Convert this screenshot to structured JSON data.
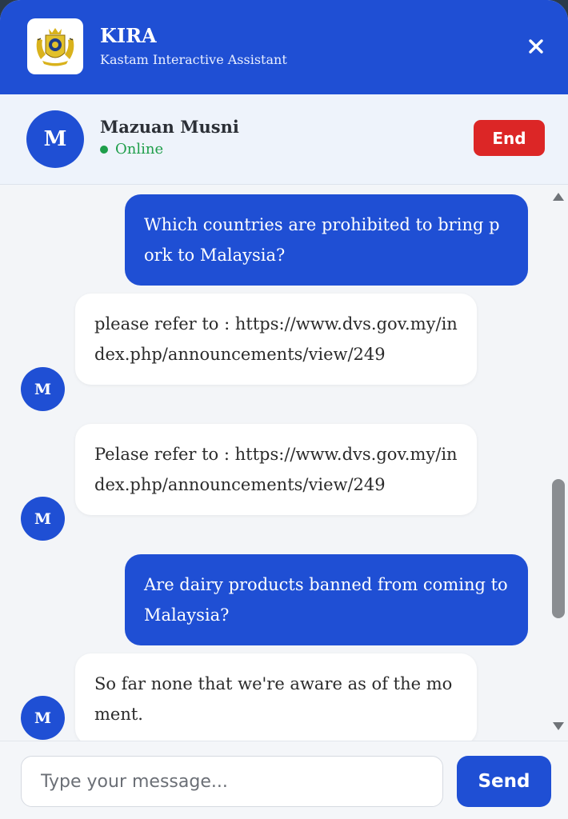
{
  "header": {
    "title": "KIRA",
    "subtitle": "Kastam Interactive Assistant",
    "logo_icon": "customs-crest-icon",
    "close_icon": "close-icon"
  },
  "agent": {
    "initial": "M",
    "name": "Mazuan Musni",
    "status": "Online",
    "end_label": "End"
  },
  "messages": [
    {
      "from": "user",
      "text": "Which countries are prohibited to bring pork to Malaysia?"
    },
    {
      "from": "agent",
      "initial": "M",
      "text": "please refer to : https://www.dvs.gov.my/index.php/announcements/view/249"
    },
    {
      "from": "agent",
      "initial": "M",
      "text": "Pelase refer to : https://www.dvs.gov.my/index.php/announcements/view/249"
    },
    {
      "from": "user",
      "text": "Are dairy products banned from coming to Malaysia?"
    },
    {
      "from": "agent",
      "initial": "M",
      "text": "So far none that we're aware as of the moment."
    }
  ],
  "composer": {
    "placeholder": "Type your message...",
    "value": "",
    "send_label": "Send"
  },
  "colors": {
    "primary": "#1f4fd4",
    "online": "#1e9e4a",
    "end_button": "#dc2626"
  }
}
